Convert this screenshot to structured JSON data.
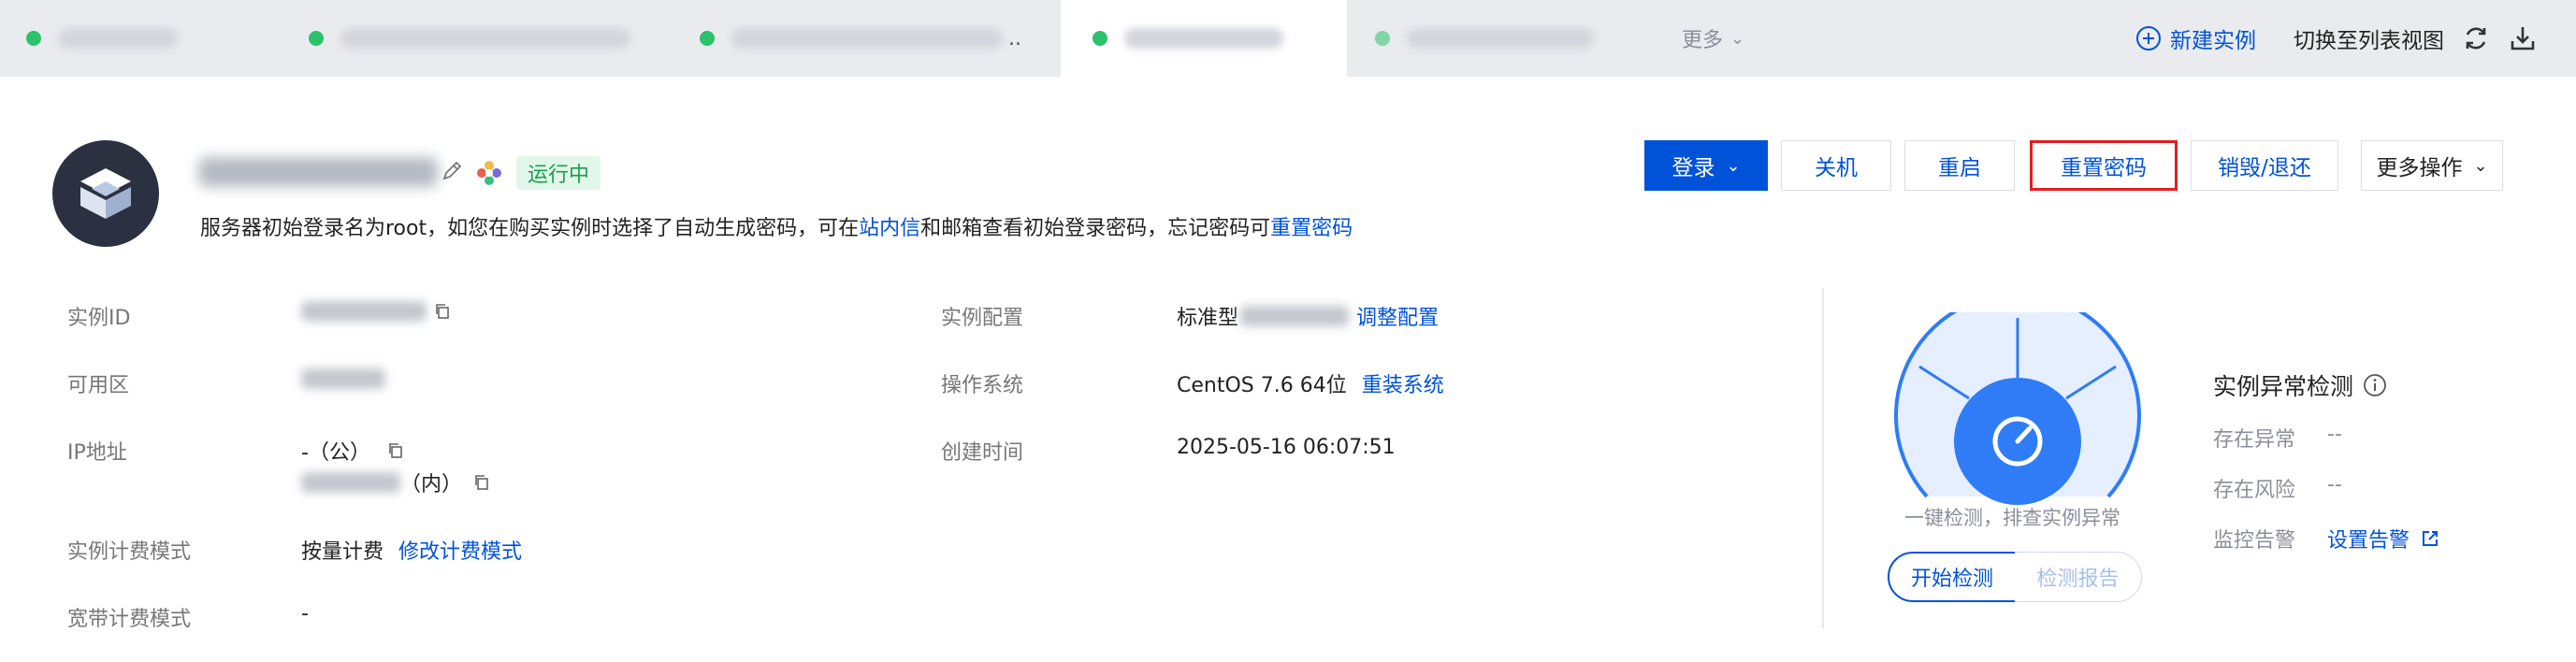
{
  "tabs": {
    "more_label": "更多",
    "ellipsis": ".."
  },
  "toolbar": {
    "new_instance_label": "新建实例",
    "switch_list_label": "切换至列表视图"
  },
  "instance": {
    "status": "运行中",
    "login_hint_prefix": "服务器初始登录名为root，如您在购买实例时选择了自动生成密码，可在",
    "login_hint_link1": "站内信",
    "login_hint_mid": "和邮箱查看初始登录密码，忘记密码可",
    "login_hint_link2": "重置密码"
  },
  "actions": {
    "login": "登录",
    "shutdown": "关机",
    "restart": "重启",
    "reset_password": "重置密码",
    "destroy": "销毁/退还",
    "more_ops": "更多操作"
  },
  "details": {
    "instance_id_label": "实例ID",
    "zone_label": "可用区",
    "ip_label": "IP地址",
    "ip_public": "-（公）",
    "ip_private_suffix": "（内）",
    "billing_label": "实例计费模式",
    "billing_value": "按量计费",
    "billing_link": "修改计费模式",
    "bandwidth_label": "宽带计费模式",
    "bandwidth_value": "-",
    "config_label": "实例配置",
    "config_value": "标准型",
    "config_link": "调整配置",
    "os_label": "操作系统",
    "os_value": "CentOS 7.6 64位",
    "os_link": "重装系统",
    "created_label": "创建时间",
    "created_value": "2025-05-16 06:07:51"
  },
  "detection": {
    "caption": "一键检测，排查实例异常",
    "start_label": "开始检测",
    "report_label": "检测报告",
    "title": "实例异常检测",
    "exception_label": "存在异常",
    "exception_value": "--",
    "risk_label": "存在风险",
    "risk_value": "--",
    "alarm_label": "监控告警",
    "alarm_link": "设置告警"
  },
  "colors": {
    "accent": "#0052d9",
    "running": "#2bc26c",
    "highlight_border": "#e0201f",
    "tab_bg": "#e9ebee"
  },
  "icons": [
    "plus-icon",
    "refresh-icon",
    "download-icon",
    "pencil-icon",
    "flower-icon",
    "copy-icon",
    "info-icon",
    "external-link-icon",
    "chevron-down-icon",
    "gauge-icon"
  ]
}
